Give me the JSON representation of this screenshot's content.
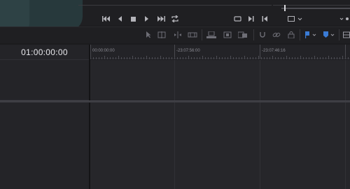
{
  "viewer": {
    "timecode": "01:00:00:00"
  },
  "ruler": {
    "marks": [
      "00:00:00:00",
      "-23:07:56:00",
      "-23:07:46:16"
    ]
  },
  "colors": {
    "background": "#1b1b1e",
    "panel": "#242428",
    "track_area": "#26262a",
    "flag_blue": "#3a7bd5",
    "marker_blue": "#3a7bd5",
    "timecode_text": "#e8e8ec"
  },
  "transport": {
    "icons": [
      "skip-to-start-icon",
      "step-back-icon",
      "stop-icon",
      "play-icon",
      "skip-to-end-icon",
      "loop-icon"
    ]
  },
  "edit_tools": {
    "icons": [
      "pointer-icon",
      "trim-icon",
      "blade-icon",
      "slip-icon",
      "insert-clip-icon",
      "overwrite-clip-icon",
      "replace-clip-icon",
      "snapping-icon",
      "link-icon",
      "lock-icon",
      "flag-icon",
      "marker-icon",
      "layout-icon"
    ]
  }
}
